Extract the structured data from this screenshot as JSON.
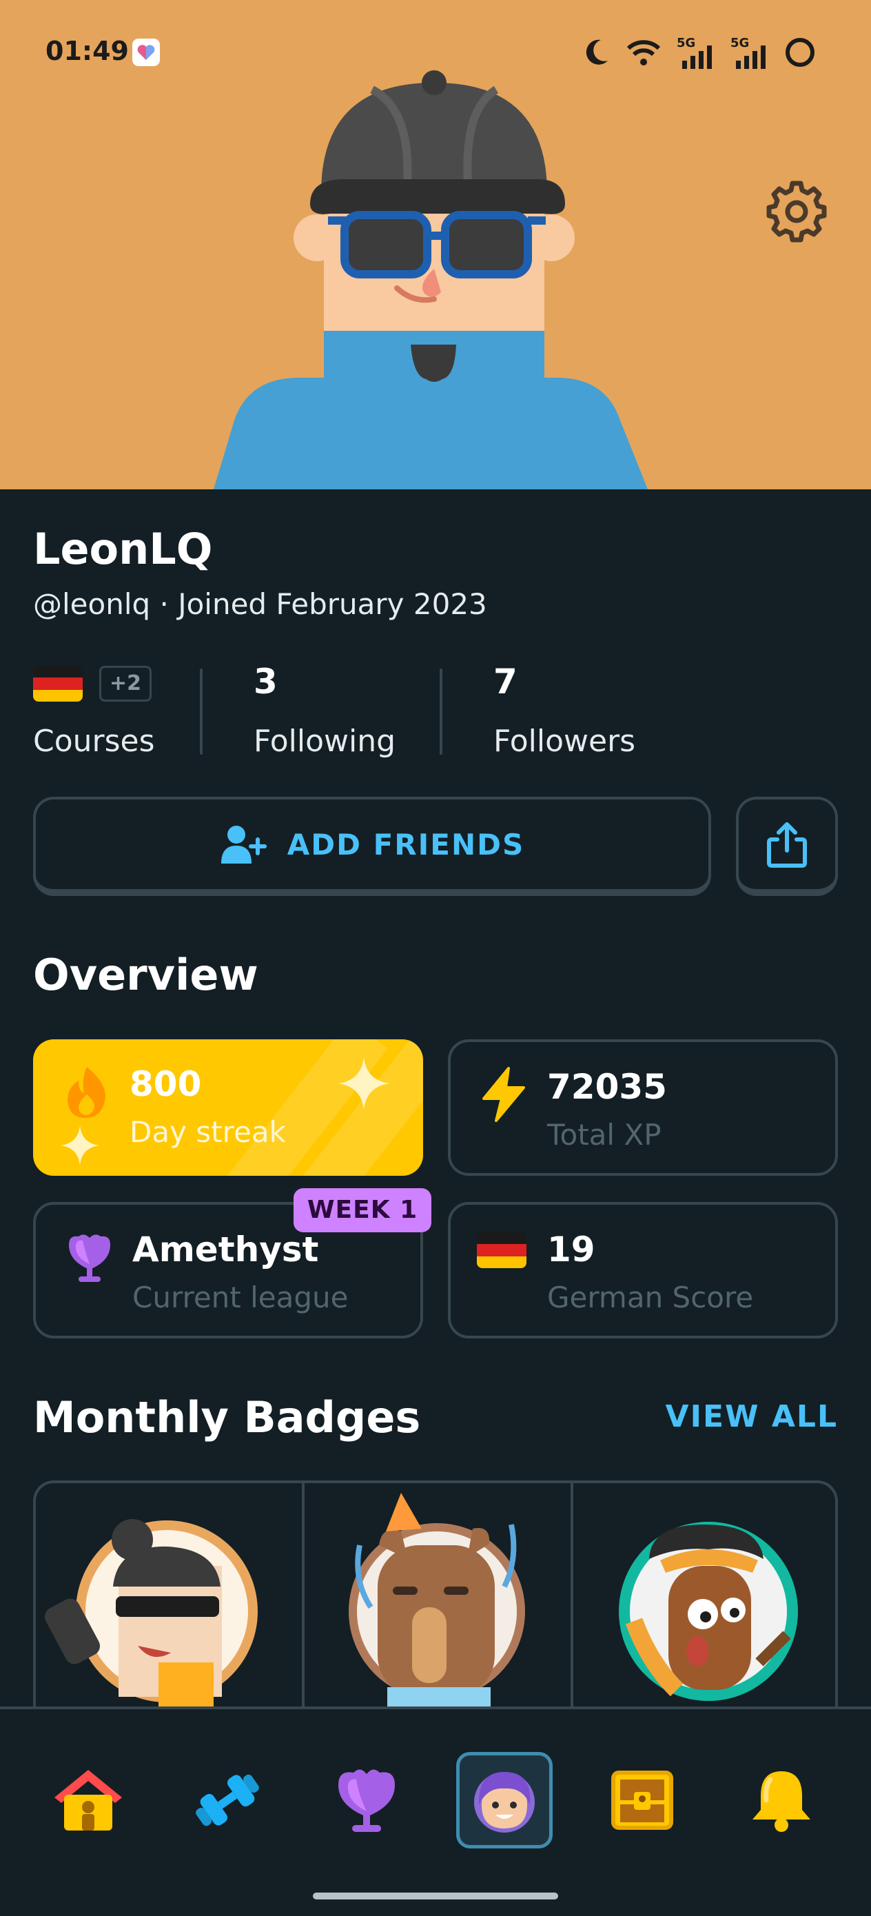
{
  "status_bar": {
    "time": "01:49",
    "network_1": "5G",
    "network_2": "5G"
  },
  "profile": {
    "name": "LeonLQ",
    "handle_line": "@leonlq · Joined February 2023",
    "extra_courses_count": "+2",
    "following_count": "3",
    "followers_count": "7",
    "courses_label": "Courses",
    "following_label": "Following",
    "followers_label": "Followers"
  },
  "actions": {
    "add_friends_label": "ADD FRIENDS"
  },
  "overview": {
    "title": "Overview",
    "streak_value": "800",
    "streak_label": "Day streak",
    "xp_value": "72035",
    "xp_label": "Total XP",
    "league_value": "Amethyst",
    "league_label": "Current league",
    "league_badge": "WEEK 1",
    "score_value": "19",
    "score_label": "German Score"
  },
  "badges": {
    "title": "Monthly Badges",
    "view_all_label": "VIEW ALL"
  },
  "colors": {
    "header_bg": "#e5a45b",
    "page_bg": "#131f24",
    "border": "#37464f",
    "accent_blue": "#49c0f8",
    "streak_yellow": "#ffc800",
    "league_purple": "#ce82ff"
  },
  "icons": {
    "settings": "gear-icon",
    "add_friend": "add-user-icon",
    "share": "share-icon",
    "streak": "fire-icon",
    "xp": "lightning-icon",
    "league": "amethyst-trophy-icon",
    "score": "german-flag-icon",
    "nav": [
      "home-icon",
      "dumbbell-icon",
      "league-icon",
      "profile-icon",
      "chest-icon",
      "bell-icon"
    ]
  }
}
